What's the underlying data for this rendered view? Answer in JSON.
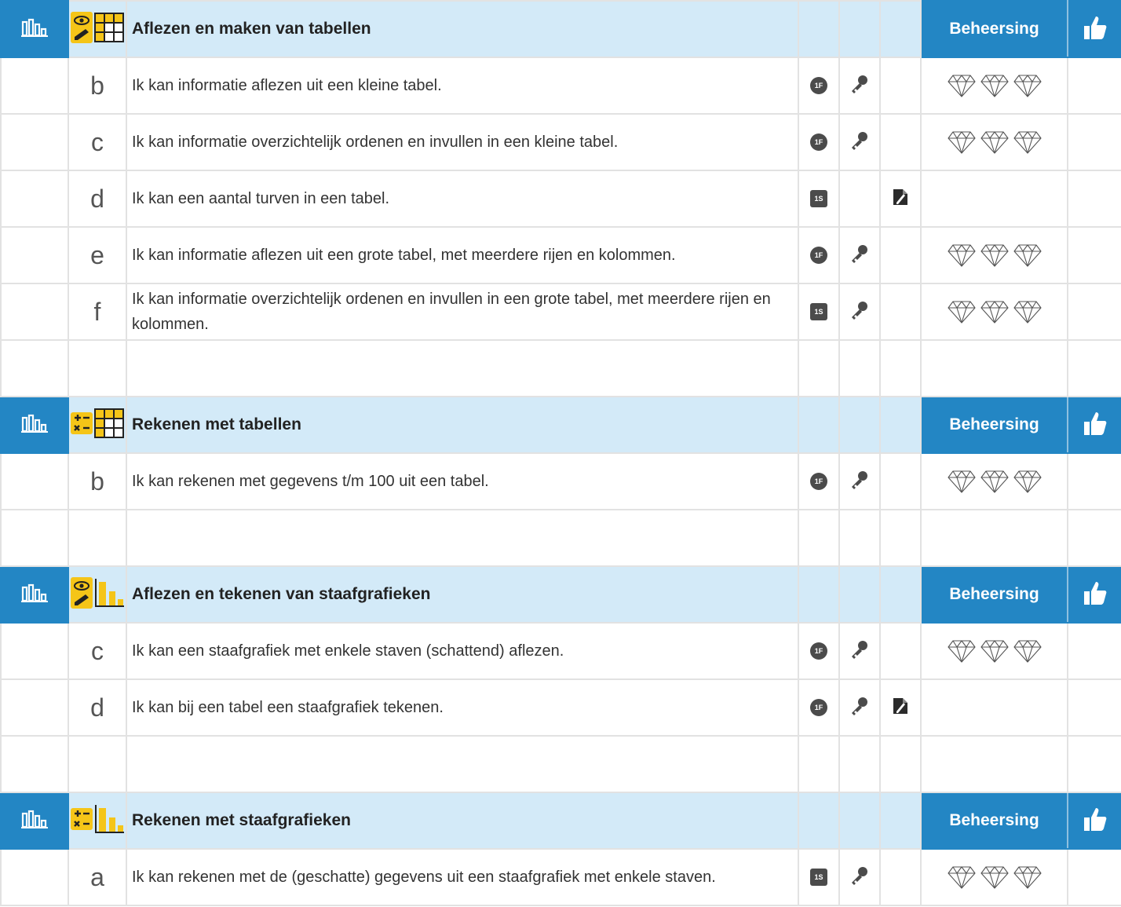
{
  "header_label": "Beheersing",
  "colors": {
    "accent": "#2386c4",
    "header_bg": "#d3eaf8",
    "badge": "#4b4b4b",
    "topic_icon_bg": "#f5c518"
  },
  "sections": [
    {
      "title": "Aflezen en maken van tabellen",
      "topic_icons": [
        "eye-pencil-icon",
        "table-icon"
      ],
      "items": [
        {
          "letter": "b",
          "text": "Ik kan informatie aflezen uit een kleine tabel.",
          "level": "1F",
          "level_shape": "round",
          "key": true,
          "doc": false,
          "gems": 3
        },
        {
          "letter": "c",
          "text": "Ik kan informatie overzichtelijk ordenen en invullen in een kleine tabel.",
          "level": "1F",
          "level_shape": "round",
          "key": true,
          "doc": false,
          "gems": 3
        },
        {
          "letter": "d",
          "text": "Ik kan een aantal turven in een tabel.",
          "level": "1S",
          "level_shape": "square",
          "key": false,
          "doc": true,
          "gems": 0
        },
        {
          "letter": "e",
          "text": "Ik kan informatie aflezen uit een grote tabel, met meerdere rijen en kolommen.",
          "level": "1F",
          "level_shape": "round",
          "key": true,
          "doc": false,
          "gems": 3
        },
        {
          "letter": "f",
          "text": "Ik kan informatie overzichtelijk ordenen en invullen in een grote tabel, met meerdere rijen en kolommen.",
          "level": "1S",
          "level_shape": "square",
          "key": true,
          "doc": false,
          "gems": 3
        }
      ]
    },
    {
      "title": "Rekenen met tabellen",
      "topic_icons": [
        "calculator-icon",
        "table-icon"
      ],
      "items": [
        {
          "letter": "b",
          "text": "Ik kan rekenen met gegevens t/m 100 uit een tabel.",
          "level": "1F",
          "level_shape": "round",
          "key": true,
          "doc": false,
          "gems": 3
        }
      ]
    },
    {
      "title": "Aflezen en tekenen van staafgrafieken",
      "topic_icons": [
        "eye-pencil-icon",
        "bar-chart-icon"
      ],
      "items": [
        {
          "letter": "c",
          "text": "Ik kan een staafgrafiek met enkele staven (schattend) aflezen.",
          "level": "1F",
          "level_shape": "round",
          "key": true,
          "doc": false,
          "gems": 3
        },
        {
          "letter": "d",
          "text": "Ik kan bij een tabel een staafgrafiek tekenen.",
          "level": "1F",
          "level_shape": "round",
          "key": true,
          "doc": true,
          "gems": 0
        }
      ]
    },
    {
      "title": "Rekenen met staafgrafieken",
      "topic_icons": [
        "calculator-icon",
        "bar-chart-icon"
      ],
      "items": [
        {
          "letter": "a",
          "text": "Ik kan rekenen met de (geschatte) gegevens uit een staafgrafiek met enkele staven.",
          "level": "1S",
          "level_shape": "square",
          "key": true,
          "doc": false,
          "gems": 3
        }
      ]
    }
  ]
}
